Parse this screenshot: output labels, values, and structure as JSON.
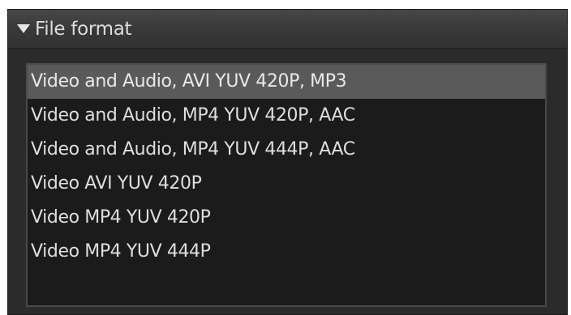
{
  "panel": {
    "title": "File format",
    "expanded": true,
    "icon": "triangle-down-icon"
  },
  "format_list": {
    "selected_index": 0,
    "items": [
      {
        "label": "Video and Audio, AVI YUV 420P, MP3"
      },
      {
        "label": "Video and Audio, MP4 YUV 420P, AAC"
      },
      {
        "label": "Video and Audio, MP4 YUV 444P, AAC"
      },
      {
        "label": "Video AVI YUV 420P"
      },
      {
        "label": "Video MP4 YUV 420P"
      },
      {
        "label": "Video MP4 YUV 444P"
      }
    ]
  },
  "colors": {
    "panel_bg": "#2b2b2b",
    "list_bg": "#1b1b1b",
    "selection_bg": "#5a5a5a",
    "text": "#dedede"
  }
}
